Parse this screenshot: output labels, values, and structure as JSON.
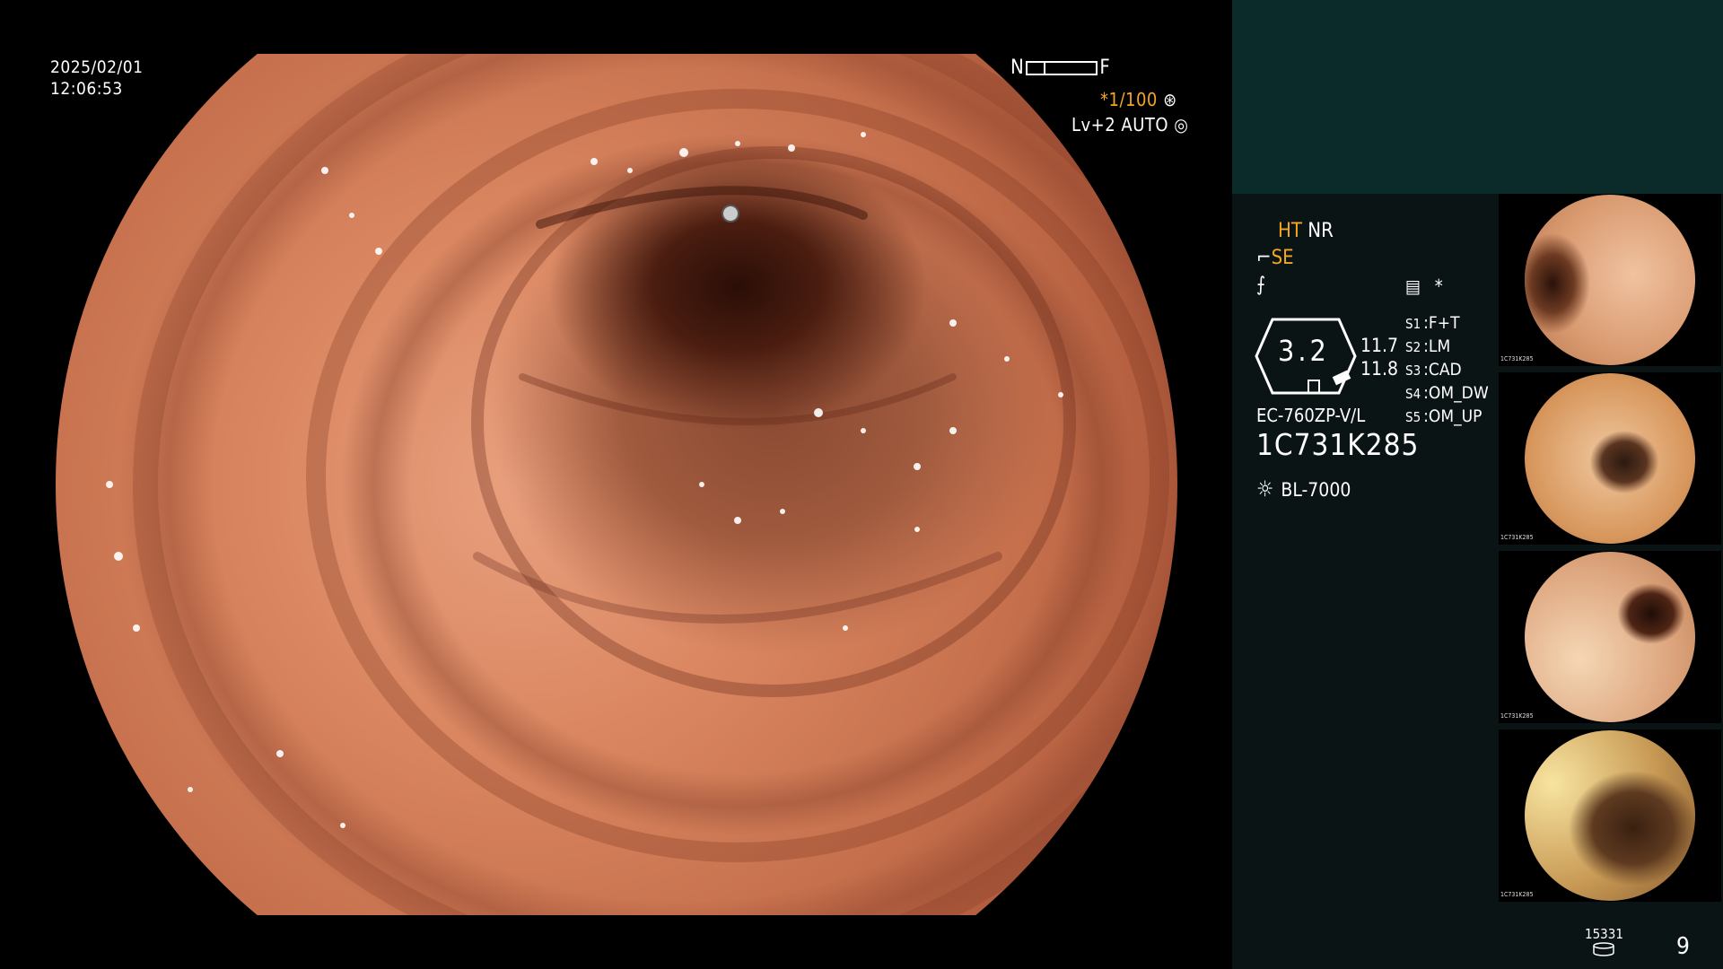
{
  "overlay": {
    "date": "2025/02/01",
    "time": "12:06:53",
    "near_label": "N",
    "far_label": "F",
    "shutter": "*1/100",
    "shutter_icon": "⊛",
    "level_auto": "Lv+2 AUTO",
    "auto_icon": "◎"
  },
  "panel": {
    "mode_ht": "HT",
    "mode_nr": "NR",
    "mode_se": "SE",
    "mode_se_icon": "⌐",
    "mode_f_icon": "⨍",
    "memo_icon": "▤",
    "star_icon": "*",
    "gauge_value": "3.2",
    "gauge_r1": "11.7",
    "gauge_r2": "11.8",
    "scope_model": "EC-760ZP-V/L",
    "serial": "1C731K285",
    "light_icon": "☼",
    "light_source": "BL-7000",
    "switches": [
      {
        "key": "S1",
        "value": "F+T"
      },
      {
        "key": "S2",
        "value": "LM"
      },
      {
        "key": "S3",
        "value": "CAD"
      },
      {
        "key": "S4",
        "value": "OM_DW"
      },
      {
        "key": "S5",
        "value": "OM_UP"
      }
    ],
    "image_counter": "15331",
    "page_number": "9"
  },
  "thumbnails": [
    {
      "caption": "1C731K285"
    },
    {
      "caption": "1C731K285"
    },
    {
      "caption": "1C731K285"
    },
    {
      "caption": "1C731K285"
    }
  ],
  "colors": {
    "accent": "#f5a623",
    "panel_bg": "#0b1415",
    "panel_top_bg": "#0b2a2a"
  }
}
